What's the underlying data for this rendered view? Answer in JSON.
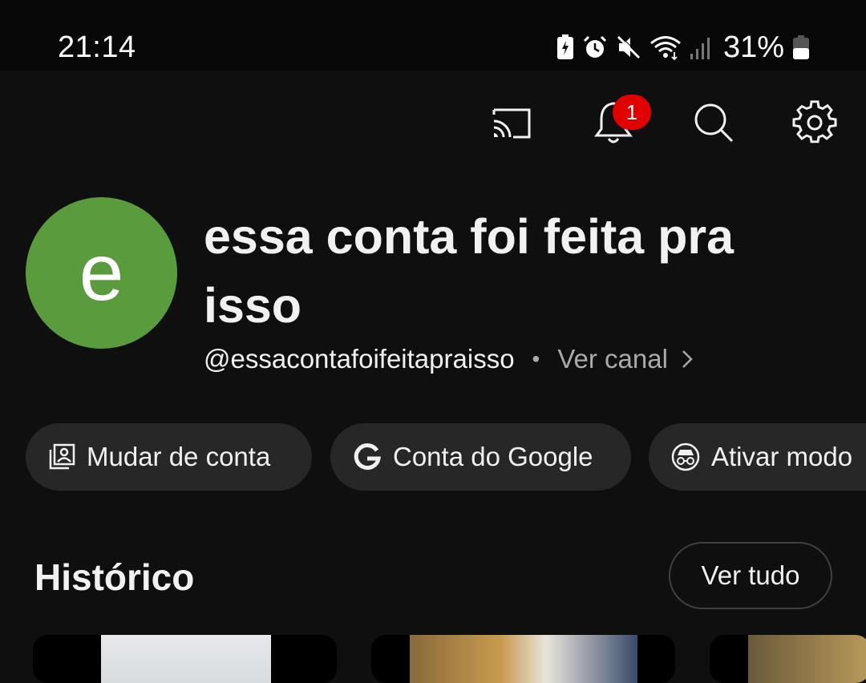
{
  "status_bar": {
    "time": "21:14",
    "battery_percent": "31%",
    "icons": [
      "battery-saver-icon",
      "alarm-icon",
      "mute-icon",
      "wifi-icon",
      "signal-icon",
      "battery-icon"
    ]
  },
  "top_bar": {
    "icons": [
      "cast-icon",
      "notifications-icon",
      "search-icon",
      "settings-icon"
    ],
    "notification_count": "1",
    "badge_color": "#e00000"
  },
  "profile": {
    "avatar_letter": "e",
    "avatar_color": "#5a9c3d",
    "channel_name": "essa conta foi feita pra isso",
    "handle": "@essacontafoifeitapraisso",
    "separator": "•",
    "view_channel_label": "Ver canal"
  },
  "actions": [
    {
      "label": "Mudar de conta",
      "icon": "switch-account-icon"
    },
    {
      "label": "Conta do Google",
      "icon": "google-g-icon"
    },
    {
      "label": "Ativar modo",
      "icon": "incognito-icon"
    }
  ],
  "history": {
    "title": "Histórico",
    "see_all_label": "Ver tudo"
  }
}
